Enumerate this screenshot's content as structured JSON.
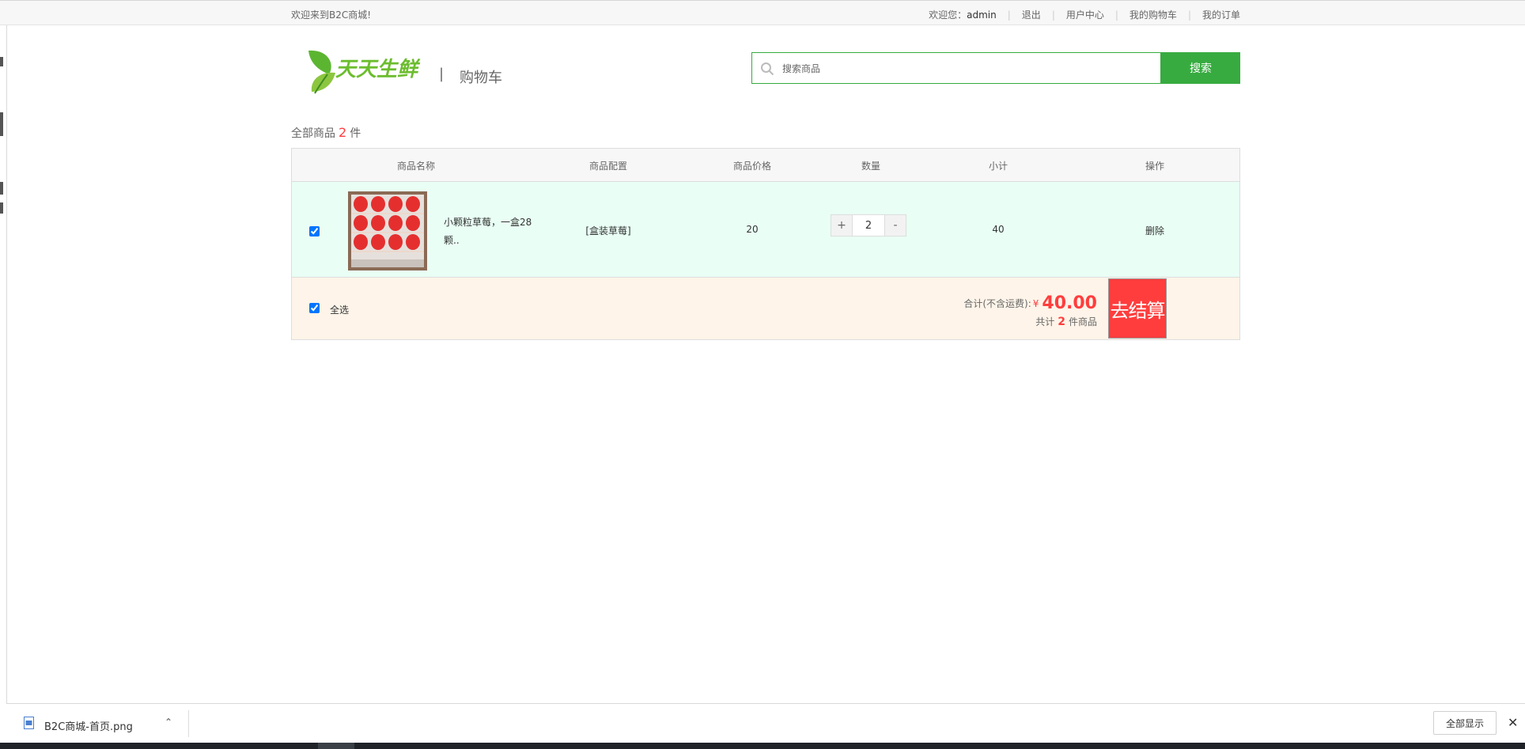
{
  "topbar": {
    "welcome": "欢迎来到B2C商城!",
    "greeting": "欢迎您：",
    "username": "admin",
    "links": [
      "退出",
      "用户中心",
      "我的购物车",
      "我的订单"
    ]
  },
  "header": {
    "logo_text": "天天生鲜",
    "separator": "|",
    "page_name": "购物车",
    "search_placeholder": "搜索商品",
    "search_button": "搜索"
  },
  "cart": {
    "count_prefix": "全部商品",
    "count": "2",
    "count_suffix": "件",
    "columns": [
      "商品名称",
      "商品配置",
      "商品价格",
      "数量",
      "小计",
      "操作"
    ],
    "items": [
      {
        "checked": true,
        "name": "小颗粒草莓，一盒28颗..",
        "config": "[盒装草莓]",
        "price": "20",
        "qty": "2",
        "qty_plus": "+",
        "qty_minus": "-",
        "subtotal": "40",
        "action": "删除"
      }
    ],
    "footer": {
      "select_all": "全选",
      "total_label": "合计(不含运费):",
      "currency": "¥",
      "total": "40.00",
      "count_prefix": "共计",
      "count": "2",
      "count_suffix": "件商品",
      "checkout": "去结算"
    }
  },
  "download_bar": {
    "filename": "B2C商城-首页.png",
    "show_all": "全部显示"
  },
  "colors": {
    "accent_green": "#37ab40",
    "price_red": "#ff3d3d",
    "row_bg": "#e9fff5",
    "footer_bg": "#fef4e9"
  }
}
